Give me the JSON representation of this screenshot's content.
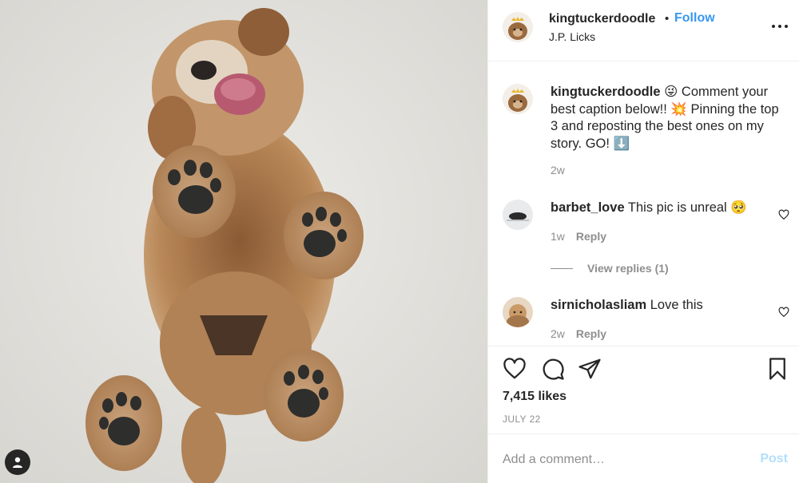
{
  "post": {
    "username": "kingtuckerdoodle",
    "dot": "•",
    "follow_label": "Follow",
    "location": "J.P. Licks"
  },
  "caption": {
    "username": "kingtuckerdoodle",
    "text": " 😜 Comment your best caption below!! 💥 Pinning the top 3 and reposting the best ones on my story. GO! ⬇️",
    "time": "2w"
  },
  "comments": [
    {
      "username": "barbet_love",
      "text": " This pic is unreal 🥺",
      "time": "1w",
      "reply_label": "Reply"
    },
    {
      "username": "sirnicholasliam",
      "text": " Love this",
      "time": "2w",
      "reply_label": "Reply"
    }
  ],
  "view_replies_label": "View replies (1)",
  "likes": "7,415 likes",
  "date": "JULY 22",
  "add_comment": {
    "placeholder": "Add a comment…",
    "post_label": "Post"
  },
  "colors": {
    "accent": "#3897f0",
    "post_disabled": "#b2dffc",
    "muted": "#8e8e8e",
    "text": "#262626"
  },
  "icons": [
    "user-tag-icon",
    "more-options-icon",
    "like-heart-icon",
    "comment-icon",
    "share-icon",
    "save-bookmark-icon"
  ]
}
